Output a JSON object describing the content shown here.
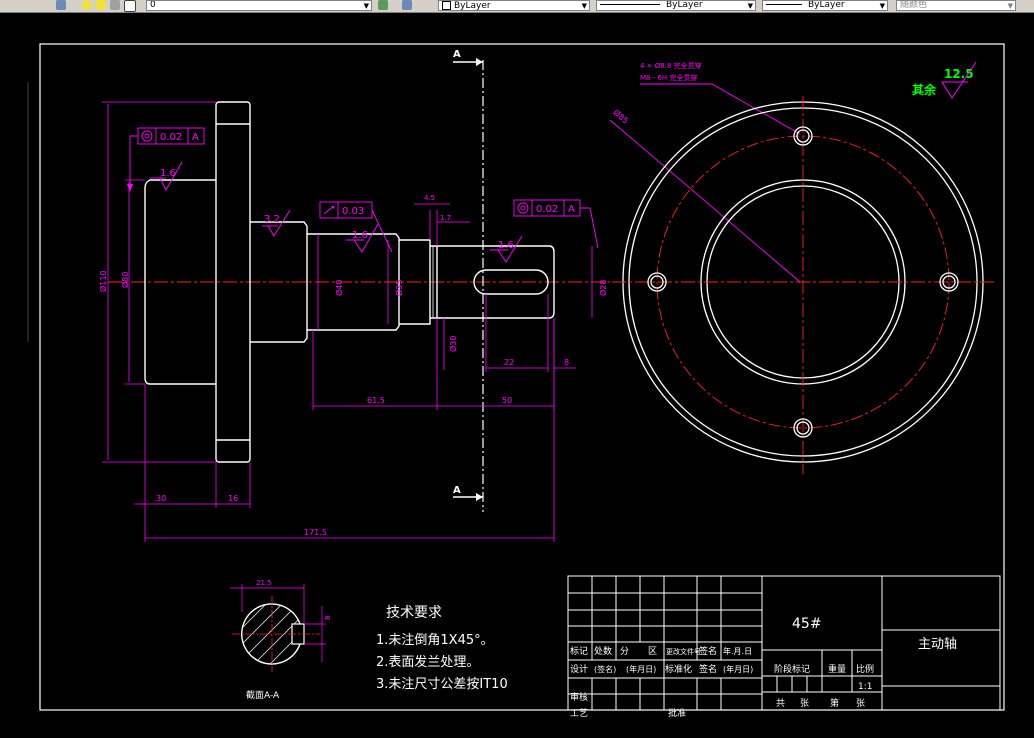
{
  "toolbar": {
    "layer_value": "0",
    "color_value": "ByLayer",
    "linetype_value": "ByLayer",
    "lineweight_value": "ByLayer",
    "plotstyle_value": "随颜色"
  },
  "section_marker": {
    "label_top": "A",
    "label_bottom": "A"
  },
  "annotations": {
    "tol_runout_left": "0.02",
    "tol_datum_left": "A",
    "tol_runout_mid": "0.03",
    "tol_runout_right": "0.02",
    "tol_datum_right": "A",
    "rough_left": "1.6",
    "rough_shaft": "3.2",
    "rough_mid": "1.6",
    "rough_right": "1.6",
    "rough_general_label": "其余",
    "rough_general_value": "12.5",
    "hole_note_1": "4 × Ø8.8 完全贯穿",
    "hole_note_2": "M8 - 6H 完全贯穿",
    "dim_diameter": "Ø85"
  },
  "dimensions": {
    "d_flange": "Ø110",
    "d_boss": "Ø80",
    "d_shaft1": "Ø40",
    "d_shaft2": "Ø35",
    "d_groove": "Ø30",
    "d_end": "Ø28",
    "len_61": "61.5",
    "len_50": "50",
    "len_22": "22",
    "len_8": "8",
    "len_30": "30",
    "len_16": "16",
    "len_total": "171.5",
    "len_4_5": "4.5",
    "len_1_7": "1.7",
    "sec_width": "21.5",
    "sec_depth": "8"
  },
  "section_view": {
    "label": "截面A-A"
  },
  "tech_requirements": {
    "title": "技术要求",
    "items": [
      "1.未注倒角1X45°。",
      "2.表面发兰处理。",
      "3.未注尺寸公差按IT10"
    ]
  },
  "title_block": {
    "material": "45#",
    "part_name": "主动轴",
    "scale": "1:1",
    "header_labels": [
      "标记",
      "处数",
      "分",
      "区",
      "更改文件号",
      "签名",
      "年.月.日"
    ],
    "row_design": [
      "设计",
      "(签名)",
      "(年月日)",
      "标准化",
      "签名",
      "(年月日)"
    ],
    "row_review": "审核",
    "row_process": "工艺",
    "row_approve": "批准",
    "stage_label": "阶段标记",
    "weight_label": "重量",
    "scale_label": "比例",
    "sheet_total": "共",
    "sheet_unit": "张",
    "sheet_num": "第",
    "sheet_unit2": "张"
  },
  "colors": {
    "outline": "#ffffff",
    "dimension": "#ff00ff",
    "center": "#ff2020",
    "roughness_text": "#00ff00"
  }
}
